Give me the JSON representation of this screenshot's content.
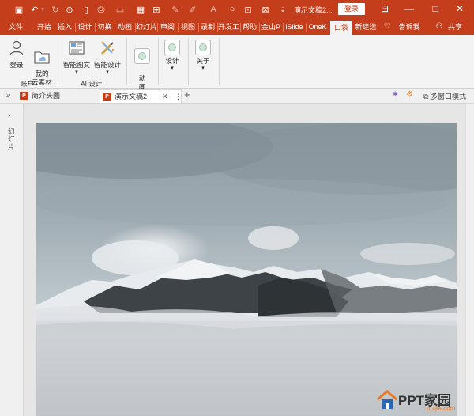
{
  "titlebar": {
    "title": "演示文稿2...",
    "login": "登录",
    "window_controls": [
      "ribbon-display-icon",
      "minimize-icon",
      "restore-icon",
      "close-icon"
    ],
    "quick_access": [
      "save-icon",
      "undo-icon",
      "redo-icon",
      "presentation-icon",
      "new-doc-icon",
      "print-icon",
      "picture-icon",
      "table-icon",
      "layout-icon",
      "pen-icon",
      "highlighter-icon",
      "text-color-icon",
      "circle-icon",
      "select-icon",
      "more-icon"
    ]
  },
  "ribbon_tabs": [
    "文件",
    "开始",
    "插入",
    "设计",
    "切换",
    "动画",
    "幻灯片",
    "审阅",
    "视图",
    "录制",
    "开发工",
    "帮助",
    "金山P",
    "iSlide",
    "OneK",
    "口袋",
    "新建选",
    "告诉我",
    "共享"
  ],
  "ribbon_active_tab": "口袋",
  "ribbon": {
    "groups": [
      {
        "label": "账户",
        "buttons": [
          {
            "label": "登录"
          },
          {
            "label": "我的\n云素材"
          }
        ]
      },
      {
        "label": "AI 设计",
        "buttons": [
          {
            "label": "智能图文"
          },
          {
            "label": "智能设计"
          }
        ]
      },
      {
        "label": "",
        "buttons": [
          {
            "label": "动\n画"
          }
        ]
      },
      {
        "label": "",
        "buttons": [
          {
            "label": "设计"
          }
        ]
      },
      {
        "label": "",
        "buttons": [
          {
            "label": "关于"
          }
        ]
      }
    ]
  },
  "doc_tabs": [
    {
      "label": "简介头图",
      "active": false
    },
    {
      "label": "演示文稿2",
      "active": true
    }
  ],
  "doc_tabs_right": {
    "window_mode": "多窗口模式"
  },
  "left_pane": {
    "label": "幻灯片"
  },
  "watermark": {
    "text": "PPT家园",
    "sub": "pptjia.com"
  },
  "colors": {
    "accent": "#c43e1c",
    "ribbon_bg": "#f3f3f3",
    "canvas_bg": "#e6e6e6"
  }
}
